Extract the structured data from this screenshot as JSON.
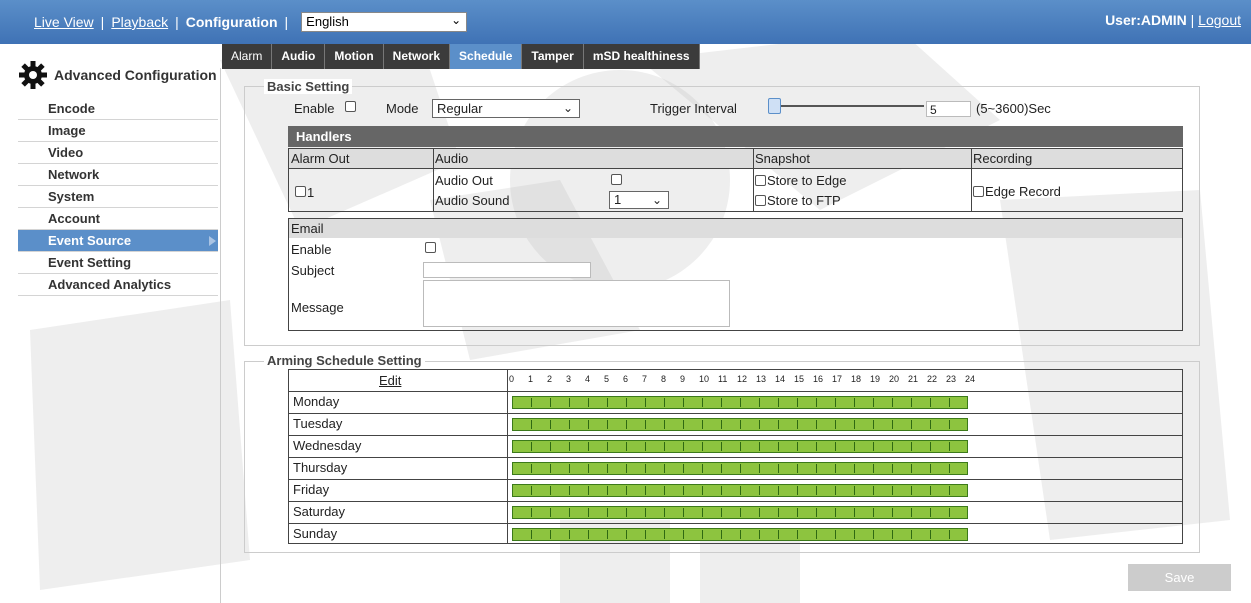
{
  "topbar": {
    "links": {
      "live_view": "Live View",
      "playback": "Playback",
      "configuration": "Configuration"
    },
    "separator": "|",
    "language": "English",
    "user_label": "User:ADMIN",
    "logout": "Logout"
  },
  "tabs": [
    "Alarm",
    "Audio",
    "Motion",
    "Network",
    "Schedule",
    "Tamper",
    "mSD healthiness"
  ],
  "active_tab": "Schedule",
  "sidebar": {
    "title": "Advanced Configuration",
    "items": [
      "Encode",
      "Image",
      "Video",
      "Network",
      "System",
      "Account",
      "Event Source",
      "Event Setting",
      "Advanced Analytics"
    ],
    "active": "Event Source"
  },
  "basic": {
    "legend": "Basic Setting",
    "enable_label": "Enable",
    "mode_label": "Mode",
    "mode_value": "Regular",
    "trigger_label": "Trigger Interval",
    "trigger_value": "5",
    "trigger_range": "(5~3600)Sec",
    "trigger_fraction": 0.0
  },
  "handlers": {
    "title": "Handlers",
    "col_alarm": "Alarm Out",
    "col_audio": "Audio",
    "col_snapshot": "Snapshot",
    "col_recording": "Recording",
    "alarm_item": "1",
    "audio_out": "Audio Out",
    "audio_sound": "Audio Sound",
    "audio_sound_value": "1",
    "store_edge": "Store to Edge",
    "store_ftp": "Store to FTP",
    "edge_record": "Edge Record"
  },
  "email": {
    "title": "Email",
    "enable": "Enable",
    "subject": "Subject",
    "message": "Message"
  },
  "schedule": {
    "legend": "Arming Schedule Setting",
    "edit": "Edit",
    "hours": [
      "0",
      "1",
      "2",
      "3",
      "4",
      "5",
      "6",
      "7",
      "8",
      "9",
      "10",
      "11",
      "12",
      "13",
      "14",
      "15",
      "16",
      "17",
      "18",
      "19",
      "20",
      "21",
      "22",
      "23",
      "24"
    ],
    "days": [
      "Monday",
      "Tuesday",
      "Wednesday",
      "Thursday",
      "Friday",
      "Saturday",
      "Sunday"
    ],
    "bar_color": "#8dc43f"
  },
  "save_label": "Save",
  "accent": "#5b8fc9"
}
